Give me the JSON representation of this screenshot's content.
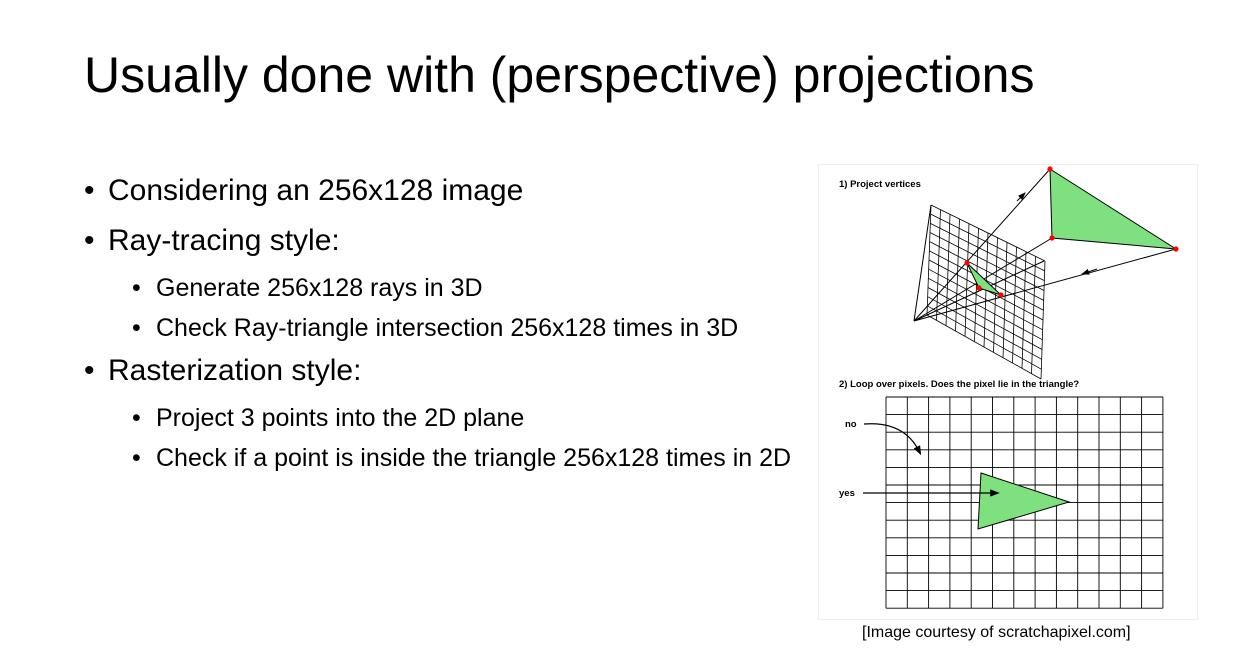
{
  "title": "Usually done with (perspective) projections",
  "bullets": [
    {
      "text": "Considering an 256x128 image",
      "sub": []
    },
    {
      "text": "Ray-tracing style:",
      "sub": [
        "Generate 256x128 rays in 3D",
        "Check Ray-triangle intersection 256x128 times in 3D"
      ]
    },
    {
      "text": "Rasterization style:",
      "sub": [
        "Project 3 points into the 2D plane",
        "Check if a point is inside the triangle 256x128 times in 2D"
      ]
    }
  ],
  "figure": {
    "step1_label": "1) Project vertices",
    "step2_label": "2) Loop over pixels. Does the pixel lie in the triangle?",
    "no_label": "no",
    "yes_label": "yes",
    "triangle_fill": "#7ee07e",
    "vertex_color": "#ff0000"
  },
  "caption": "[Image courtesy of scratchapixel.com]"
}
